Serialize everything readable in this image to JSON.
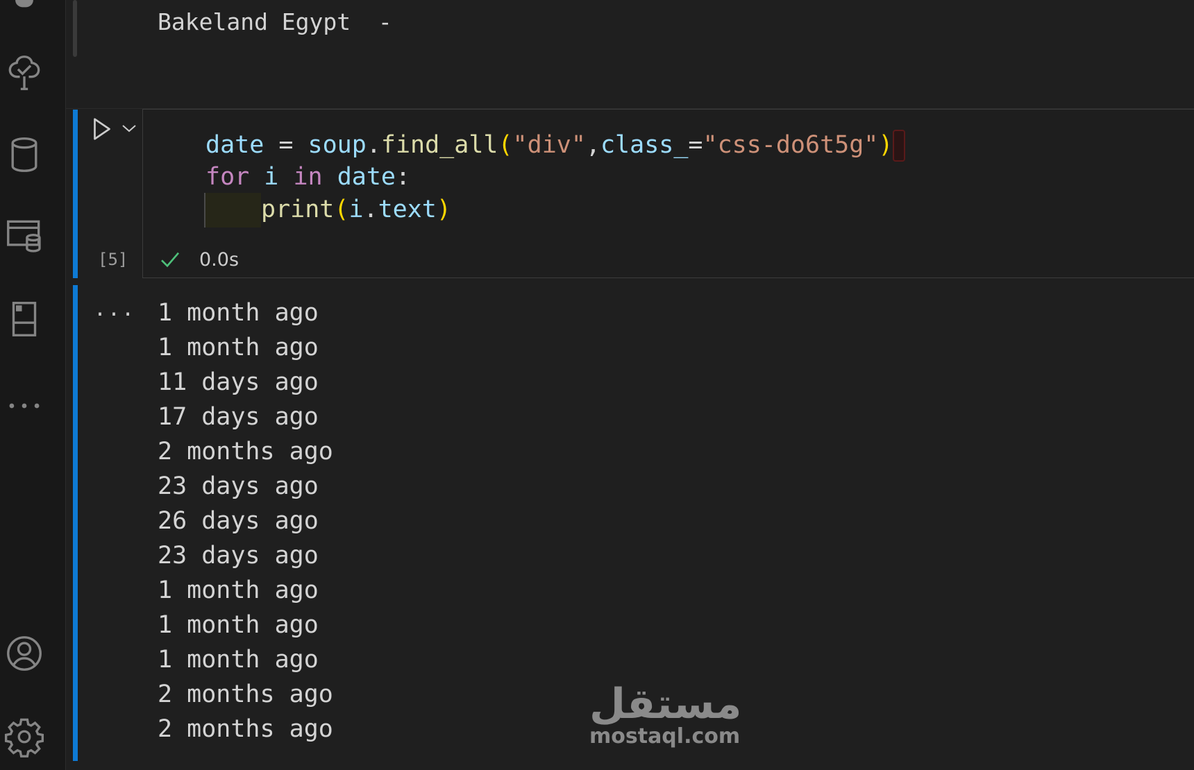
{
  "markdown": {
    "text": "Bakeland Egypt  -"
  },
  "cell": {
    "execution_count": "[5]",
    "duration": "0.0s",
    "code": {
      "line1": {
        "var": "date",
        "eq": " = ",
        "obj": "soup",
        "dot": ".",
        "fn": "find_all",
        "open": "(",
        "arg1": "\"div\"",
        "comma": ",",
        "kwarg": "class_",
        "kweq": "=",
        "arg2": "\"css-do6t5g\"",
        "close": ")"
      },
      "line2": {
        "kw_for": "for",
        "sp1": " ",
        "var_i": "i",
        "sp2": " ",
        "kw_in": "in",
        "sp3": " ",
        "var_date": "date",
        "colon": ":"
      },
      "line3": {
        "fn": "print",
        "open": "(",
        "var": "i",
        "dot": ".",
        "attr": "text",
        "close": ")"
      }
    }
  },
  "output": {
    "more_label": "...",
    "lines": [
      "1 month ago",
      "1 month ago",
      "11 days ago",
      "17 days ago",
      "2 months ago",
      "23 days ago",
      "26 days ago",
      "23 days ago",
      "1 month ago",
      "1 month ago",
      "1 month ago",
      "2 months ago",
      "2 months ago"
    ]
  },
  "watermark": {
    "logo": "مستقل",
    "domain": "mostaql.com"
  },
  "icons": {
    "activity": [
      "run-debug-icon",
      "testing-icon",
      "database-icon",
      "remote-explorer-icon",
      "notebook-icon",
      "more-icon",
      "account-icon",
      "settings-icon"
    ]
  },
  "colors": {
    "accent": "#0e7ad4",
    "keyword": "#c586c0",
    "variable": "#9cdcfe",
    "function": "#dcdcaa",
    "string": "#ce9178",
    "bracket": "#ffd700",
    "success": "#4ec07a"
  }
}
